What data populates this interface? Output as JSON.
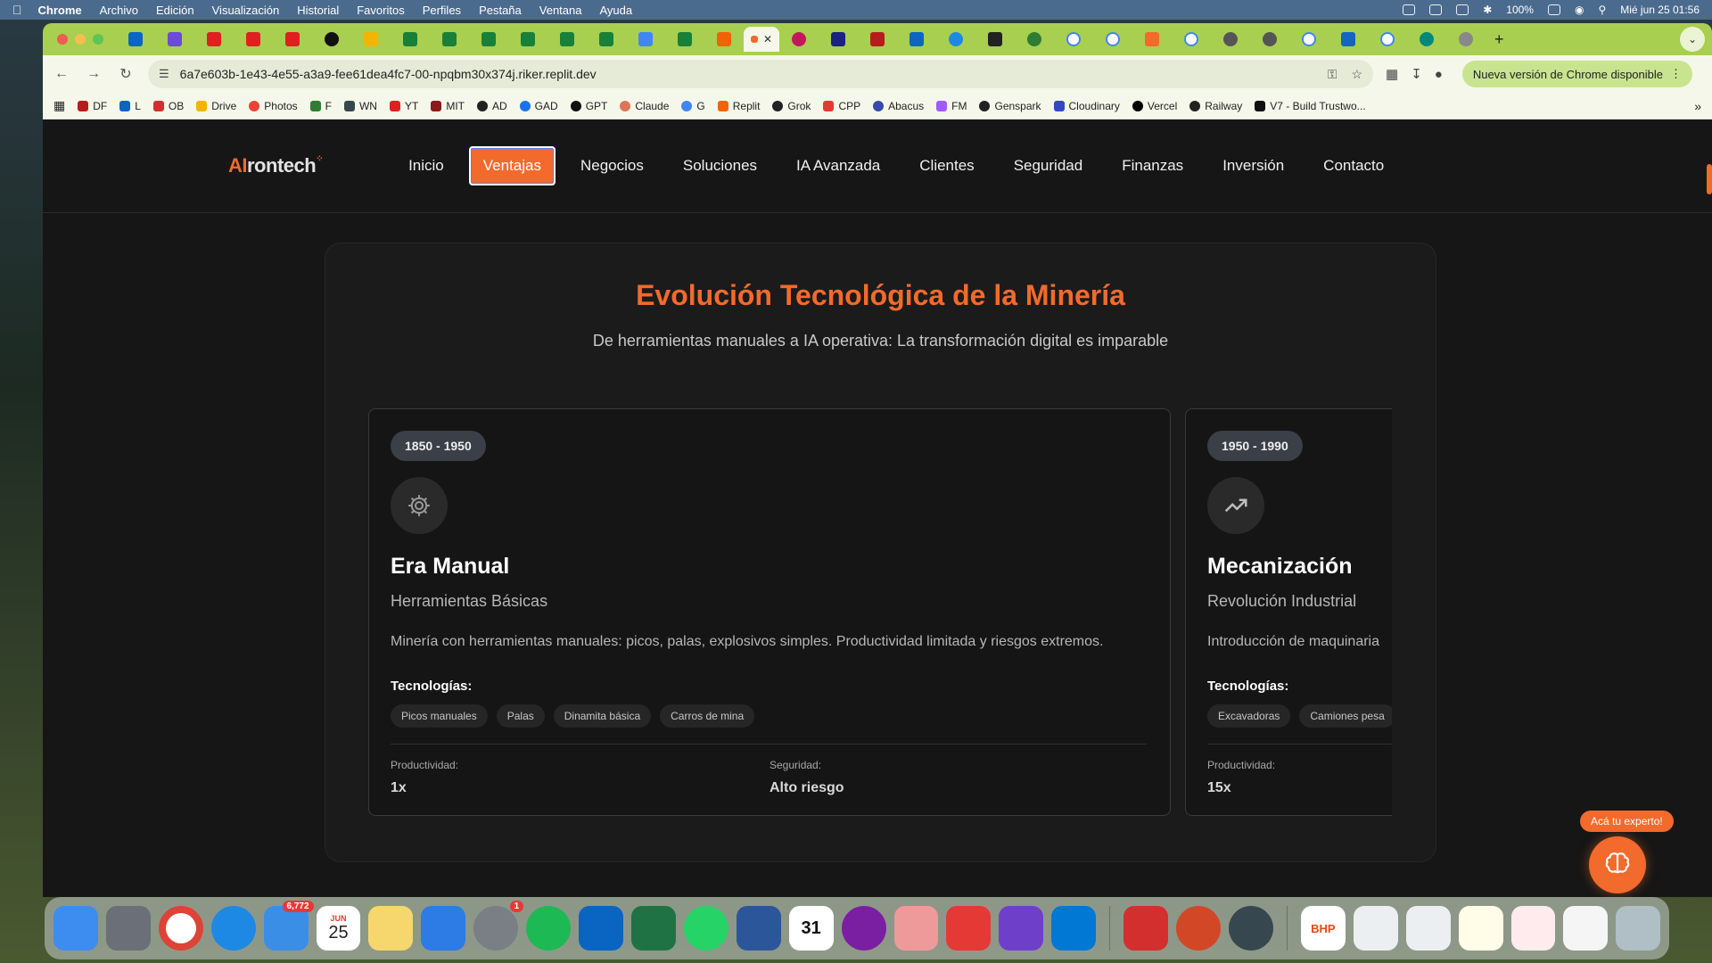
{
  "menubar": {
    "app_name": "Chrome",
    "items": [
      "Archivo",
      "Edición",
      "Visualización",
      "Historial",
      "Favoritos",
      "Perfiles",
      "Pestaña",
      "Ventana",
      "Ayuda"
    ],
    "battery": "100%",
    "datetime": "Mié jun 25  01:56"
  },
  "browser": {
    "url": "6a7e603b-1e43-4e55-a3a9-fee61dea4fc7-00-npqbm30x374j.riker.replit.dev",
    "update_label": "Nueva versión de Chrome disponible",
    "bookmarks": [
      "DF",
      "L",
      "OB",
      "Drive",
      "Photos",
      "F",
      "WN",
      "YT",
      "MIT",
      "AD",
      "GAD",
      "GPT",
      "Claude",
      "G",
      "Replit",
      "Grok",
      "CPP",
      "Abacus",
      "FM",
      "Genspark",
      "Cloudinary",
      "Vercel",
      "Railway",
      "V7 - Build Trustwo..."
    ]
  },
  "site": {
    "logo_ai": "AI",
    "logo_rest": "rontech",
    "nav": [
      "Inicio",
      "Ventajas",
      "Negocios",
      "Soluciones",
      "IA Avanzada",
      "Clientes",
      "Seguridad",
      "Finanzas",
      "Inversión",
      "Contacto"
    ],
    "active_nav": "Ventajas",
    "section_title": "Evolución Tecnológica de la Minería",
    "section_subtitle": "De herramientas manuales a IA operativa: La transformación digital es imparable",
    "cards": [
      {
        "period": "1850 - 1950",
        "icon": "gear-icon",
        "title": "Era Manual",
        "subtitle": "Herramientas Básicas",
        "description": "Minería con herramientas manuales: picos, palas, explosivos simples. Productividad limitada y riesgos extremos.",
        "tech_heading": "Tecnologías:",
        "technologies": [
          "Picos manuales",
          "Palas",
          "Dinamita básica",
          "Carros de mina"
        ],
        "stats": [
          {
            "label": "Productividad:",
            "value": "1x"
          },
          {
            "label": "Seguridad:",
            "value": "Alto riesgo"
          }
        ]
      },
      {
        "period": "1950 - 1990",
        "icon": "trending-up-icon",
        "title": "Mecanización",
        "subtitle": "Revolución Industrial",
        "description": "Introducción de maquinaria",
        "tech_heading": "Tecnologías:",
        "technologies": [
          "Excavadoras",
          "Camiones pesa"
        ],
        "stats": [
          {
            "label": "Productividad:",
            "value": "15x"
          }
        ]
      }
    ],
    "expert_label": "Acá tu experto!"
  },
  "dock": {
    "mail_badge": "6,772",
    "calendar_month": "JUN",
    "calendar_day": "25",
    "settings_badge": "1",
    "bhp_label": "BHP"
  },
  "colors": {
    "accent": "#f26a2c",
    "tabstrip": "#a8cf4f",
    "page_bg": "#161616"
  }
}
